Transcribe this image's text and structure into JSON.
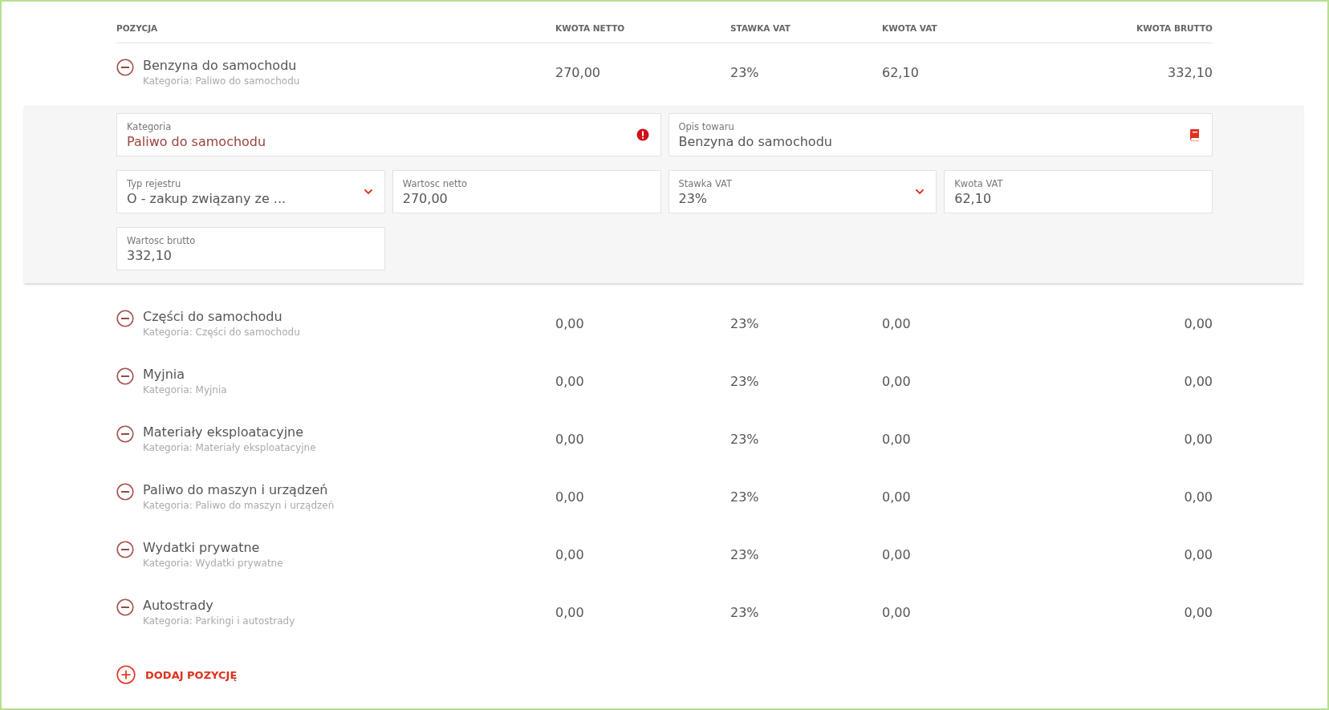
{
  "columns": [
    "POZYCJA",
    "KWOTA NETTO",
    "STAWKA VAT",
    "KWOTA VAT",
    "KWOTA BRUTTO"
  ],
  "items": [
    {
      "name": "Benzyna do samochodu",
      "category": "Kategoria: Paliwo do samochodu",
      "netto": "270,00",
      "rate": "23%",
      "vat": "62,10",
      "brutto": "332,10",
      "expanded": true
    },
    {
      "name": "Części do samochodu",
      "category": "Kategoria: Części do samochodu",
      "netto": "0,00",
      "rate": "23%",
      "vat": "0,00",
      "brutto": "0,00",
      "expanded": false
    },
    {
      "name": "Myjnia",
      "category": "Kategoria: Myjnia",
      "netto": "0,00",
      "rate": "23%",
      "vat": "0,00",
      "brutto": "0,00",
      "expanded": false
    },
    {
      "name": "Materiały eksploatacyjne",
      "category": "Kategoria: Materiały eksploatacyjne",
      "netto": "0,00",
      "rate": "23%",
      "vat": "0,00",
      "brutto": "0,00",
      "expanded": false
    },
    {
      "name": "Paliwo do maszyn i urządzeń",
      "category": "Kategoria: Paliwo do maszyn i urządzeń",
      "netto": "0,00",
      "rate": "23%",
      "vat": "0,00",
      "brutto": "0,00",
      "expanded": false
    },
    {
      "name": "Wydatki prywatne",
      "category": "Kategoria: Wydatki prywatne",
      "netto": "0,00",
      "rate": "23%",
      "vat": "0,00",
      "brutto": "0,00",
      "expanded": false
    },
    {
      "name": "Autostrady",
      "category": "Kategoria: Parkingi i autostrady",
      "netto": "0,00",
      "rate": "23%",
      "vat": "0,00",
      "brutto": "0,00",
      "expanded": false
    }
  ],
  "detail_form": {
    "fields": [
      {
        "label": "Kategoria",
        "value": "Paliwo do samochodu",
        "kind": "invalid",
        "wide": true
      },
      {
        "label": "Opis towaru",
        "value": "Benzyna do samochodu",
        "kind": "lookup",
        "wide": true
      },
      {
        "label": "Typ rejestru",
        "value": "O - zakup związany ze ...",
        "kind": "select",
        "wide": false
      },
      {
        "label": "Wartosc netto",
        "value": "270,00",
        "kind": "text",
        "wide": false
      },
      {
        "label": "Stawka VAT",
        "value": "23%",
        "kind": "select",
        "wide": false
      },
      {
        "label": "Kwota VAT",
        "value": "62,10",
        "kind": "text",
        "wide": false
      },
      {
        "label": "Wartosc brutto",
        "value": "332,10",
        "kind": "text",
        "wide": false
      }
    ]
  },
  "add_button": {
    "label": "DODAJ POZYCJĘ"
  }
}
